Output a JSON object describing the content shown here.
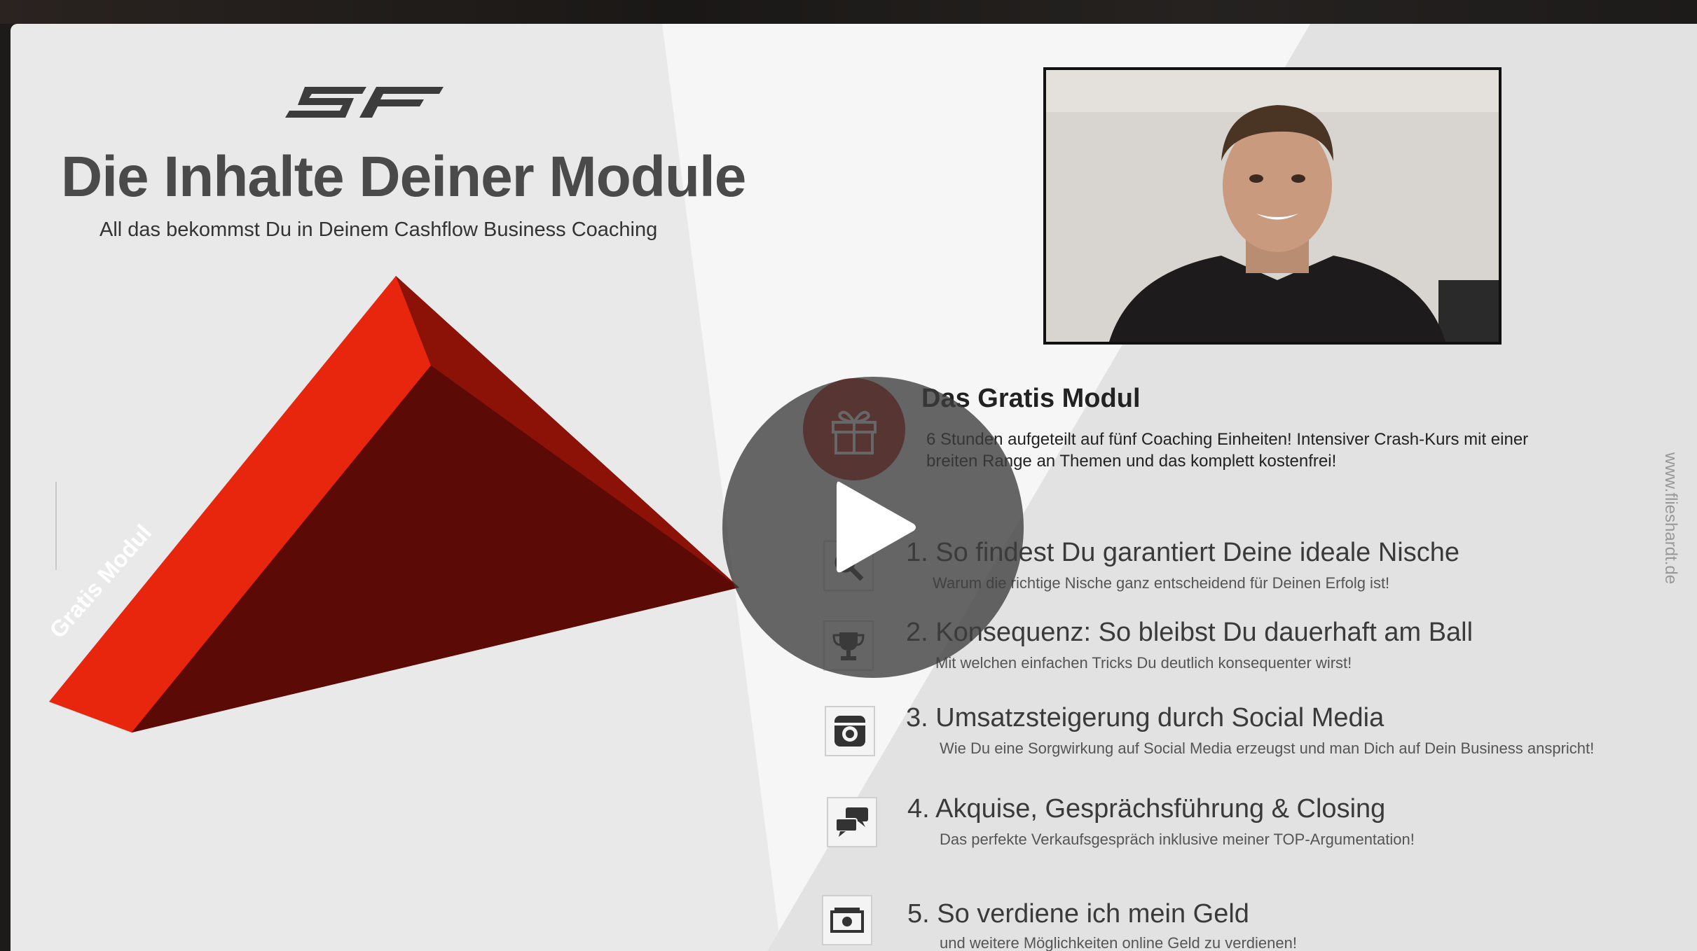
{
  "logo_text": "SF",
  "title": "Die Inhalte Deiner Module",
  "subtitle": "All das bekommst Du in Deinem Cashflow Business Coaching",
  "pyramid_label": "Gratis Modul",
  "gratis": {
    "title": "Das Gratis Modul",
    "description": "6 Stunden aufgeteilt auf fünf Coaching Einheiten! Intensiver Crash-Kurs mit einer breiten Range an Themen und das komplett kostenfrei!"
  },
  "modules": [
    {
      "title": "1. So findest Du garantiert Deine ideale Nische",
      "desc": "Warum die richtige Nische ganz entscheidend für Deinen Erfolg ist!",
      "icon": "magnifier-icon"
    },
    {
      "title": "2. Konsequenz: So bleibst Du dauerhaft am Ball",
      "desc": "Mit welchen einfachen Tricks Du deutlich konsequenter wirst!",
      "icon": "trophy-icon"
    },
    {
      "title": "3. Umsatzsteigerung durch Social Media",
      "desc": "Wie Du eine Sorgwirkung auf Social Media erzeugst und man Dich auf Dein Business anspricht!",
      "icon": "instagram-icon"
    },
    {
      "title": "4. Akquise, Gesprächsführung & Closing",
      "desc": "Das perfekte Verkaufsgespräch inklusive meiner TOP-Argumentation!",
      "icon": "chat-bubbles-icon"
    },
    {
      "title": "5. So verdiene ich mein Geld",
      "desc": "und weitere Möglichkeiten online Geld zu verdienen!",
      "icon": "money-icon"
    }
  ],
  "website": "www.flieshardt.de",
  "colors": {
    "accent_red": "#e8260e",
    "dark_red": "#6a0c08",
    "gift_red": "#b01d12"
  }
}
